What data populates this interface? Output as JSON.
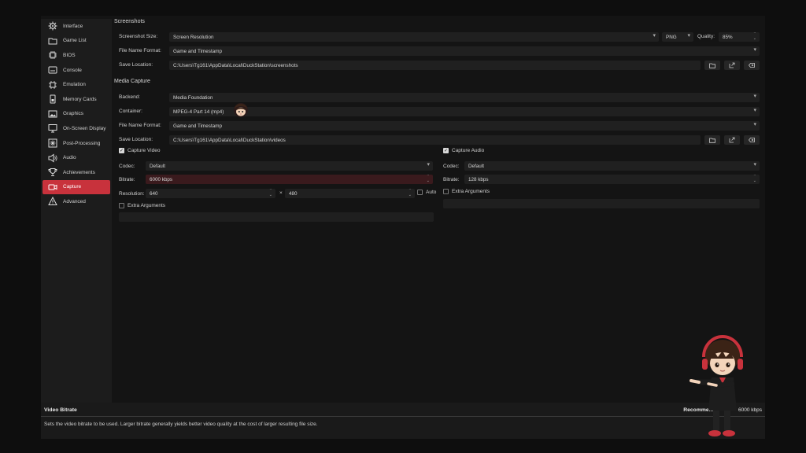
{
  "sidebar": {
    "items": [
      {
        "label": "Interface",
        "icon": "gear-icon"
      },
      {
        "label": "Game List",
        "icon": "folder-icon"
      },
      {
        "label": "BIOS",
        "icon": "chip-icon"
      },
      {
        "label": "Console",
        "icon": "console-icon"
      },
      {
        "label": "Emulation",
        "icon": "chip-icon"
      },
      {
        "label": "Memory Cards",
        "icon": "memory-card-icon"
      },
      {
        "label": "Graphics",
        "icon": "image-icon"
      },
      {
        "label": "On-Screen Display",
        "icon": "display-icon"
      },
      {
        "label": "Post-Processing",
        "icon": "sparkle-icon"
      },
      {
        "label": "Audio",
        "icon": "speaker-icon"
      },
      {
        "label": "Achievements",
        "icon": "trophy-icon"
      },
      {
        "label": "Capture",
        "icon": "camera-icon"
      },
      {
        "label": "Advanced",
        "icon": "warning-icon"
      }
    ],
    "active": "Capture",
    "accent": "#c8323c"
  },
  "screenshots": {
    "title": "Screenshots",
    "size_label": "Screenshot Size:",
    "size_value": "Screen Resolution",
    "format_value": "PNG",
    "quality_label": "Quality:",
    "quality_value": "85%",
    "filename_label": "File Name Format:",
    "filename_value": "Game and Timestamp",
    "location_label": "Save Location:",
    "location_value": "C:\\Users\\Tg161\\AppData\\Local\\DuckStation\\screenshots"
  },
  "media": {
    "title": "Media Capture",
    "backend_label": "Backend:",
    "backend_value": "Media Foundation",
    "container_label": "Container:",
    "container_value": "MPEG-4 Part 14 (mp4)",
    "filename_label": "File Name Format:",
    "filename_value": "Game and Timestamp",
    "location_label": "Save Location:",
    "location_value": "C:\\Users\\Tg161\\AppData\\Local\\DuckStation\\videos"
  },
  "video": {
    "capture_label": "Capture Video",
    "codec_label": "Codec:",
    "codec_value": "Default",
    "bitrate_label": "Bitrate:",
    "bitrate_value": "6000 kbps",
    "resolution_label": "Resolution:",
    "width_value": "640",
    "times": "×",
    "height_value": "480",
    "auto_label": "Auto",
    "extra_label": "Extra Arguments"
  },
  "audio": {
    "capture_label": "Capture Audio",
    "codec_label": "Codec:",
    "codec_value": "Default",
    "bitrate_label": "Bitrate:",
    "bitrate_value": "128 kbps",
    "extra_label": "Extra Arguments"
  },
  "help": {
    "title": "Video Bitrate",
    "recommended_label": "Recommend",
    "recommended_value": "6000 kbps",
    "text": "Sets the video bitrate to be used. Larger bitrate generally yields better video quality at the cost of larger resulting file size."
  }
}
